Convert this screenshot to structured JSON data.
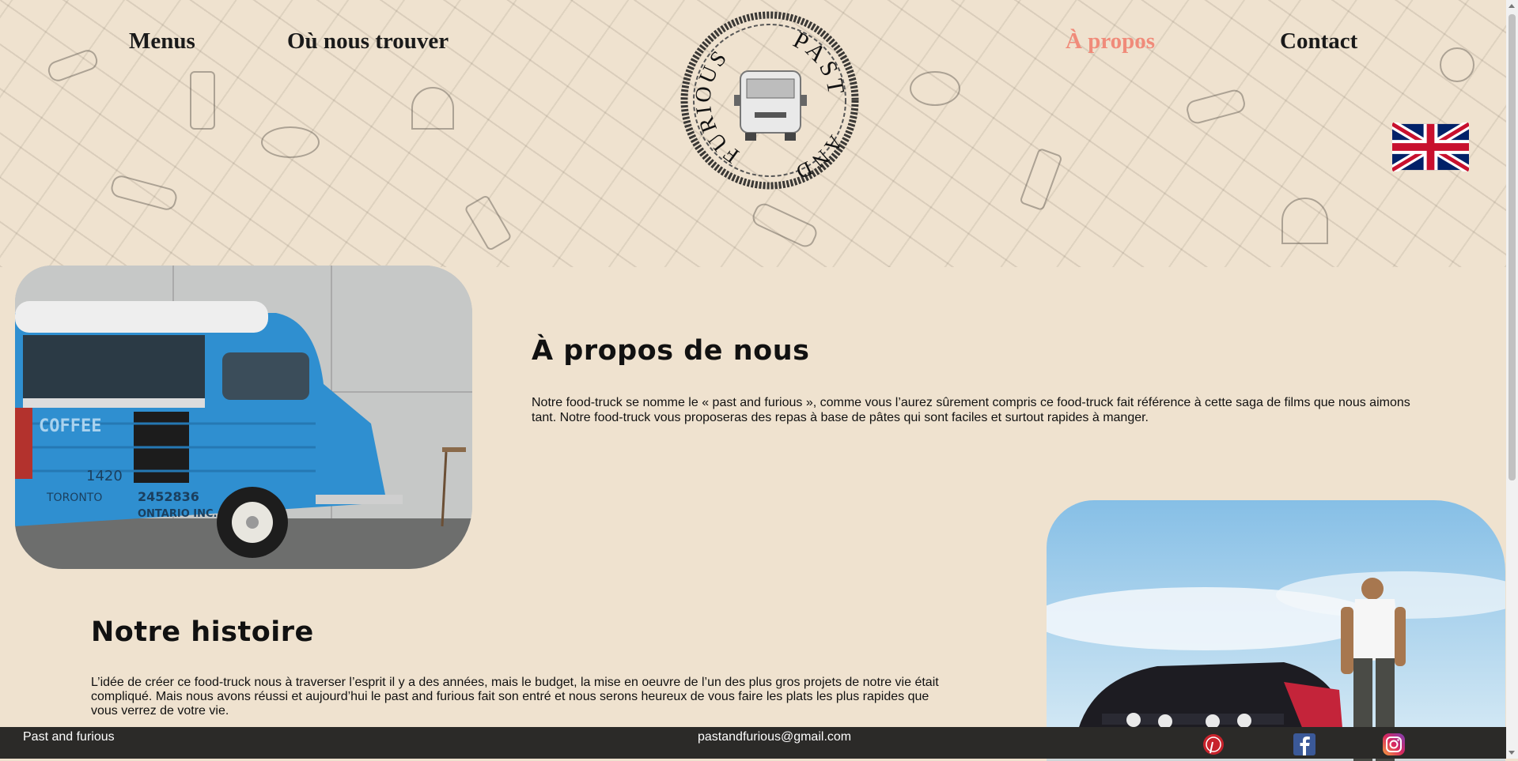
{
  "nav": {
    "menus": "Menus",
    "find_us": "Où nous trouver",
    "about": "À propos",
    "contact": "Contact"
  },
  "logo": {
    "word_top": "PAST",
    "word_left": "FURIOUS",
    "word_bottom": "AND"
  },
  "about": {
    "title": "À propos de nous",
    "text": "Notre food-truck se nomme le « past and furious », comme vous l’aurez sûrement compris ce food-truck fait référence à cette saga de films que nous aimons tant. Notre food-truck vous proposeras des repas à base de pâtes qui sont faciles et surtout rapides à manger."
  },
  "history": {
    "title": "Notre histoire",
    "text": "L’idée de créer ce food-truck nous à traverser l’esprit il y a des années, mais le budget, la mise en oeuvre de l’un des plus gros projets de notre vie était compliqué. Mais nous avons réussi et aujourd’hui le past and furious fait son entré et nous serons heureux de vous faire les plats les plus rapides que vous verrez de votre vie."
  },
  "truck_image": {
    "side_text": "COFFEE",
    "number": "1420",
    "city": "TORONTO",
    "phone": "2452836",
    "region": "ONTARIO INC."
  },
  "footer": {
    "brand": "Past and furious",
    "email": "pastandfurious@gmail.com"
  },
  "colors": {
    "background": "#efe2cf",
    "active_link": "#f08b7a",
    "footer": "#2b2a28",
    "truck_blue": "#2f8fd0"
  },
  "icons": [
    "uk-flag-icon",
    "pinterest-icon",
    "facebook-icon",
    "instagram-icon"
  ]
}
